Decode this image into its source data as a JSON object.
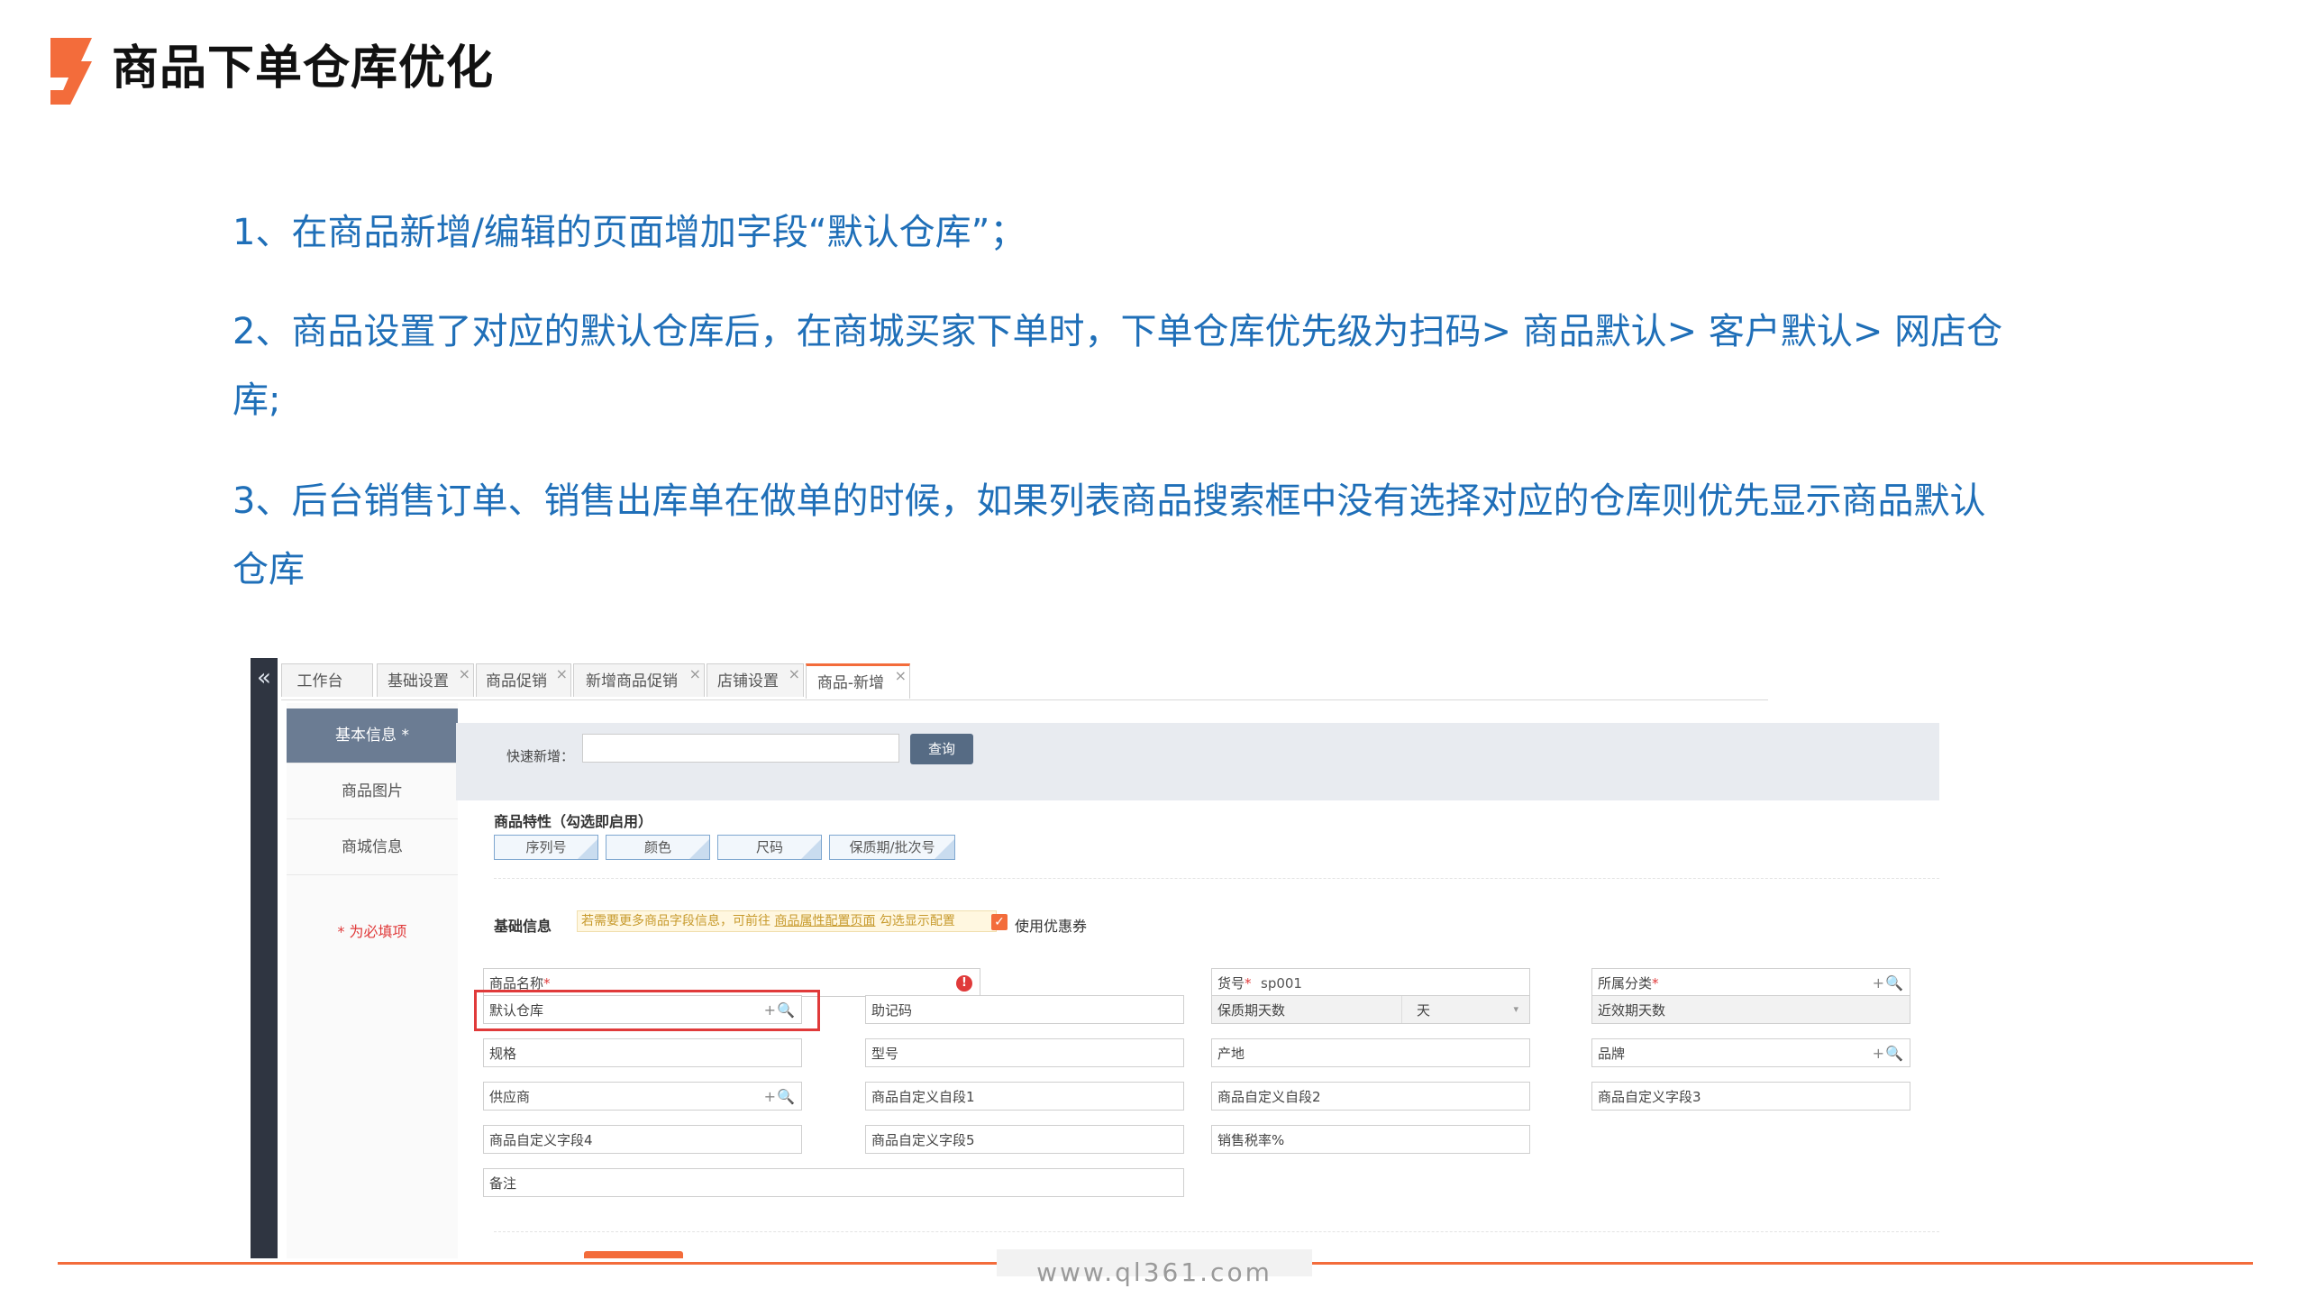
{
  "header": {
    "title": "商品下单仓库优化"
  },
  "bullets": [
    "1、在商品新增/编辑的页面增加字段“默认仓库”；",
    "2、商品设置了对应的默认仓库后，在商城买家下单时，下单仓库优先级为扫码> 商品默认> 客户默认> 网店仓库;",
    "3、后台销售订单、销售出库单在做单的时候，如果列表商品搜索框中没有选择对应的仓库则优先显示商品默认仓库"
  ],
  "screenshot": {
    "collapse_glyph": "«",
    "tabs": [
      {
        "label": "工作台",
        "close": ""
      },
      {
        "label": "基础设置",
        "close": "×"
      },
      {
        "label": "商品促销",
        "close": "×"
      },
      {
        "label": "新增商品促销",
        "close": "×"
      },
      {
        "label": "店铺设置",
        "close": "×"
      },
      {
        "label": "商品-新增",
        "close": "×"
      }
    ],
    "active_tab": "商品-新增",
    "sidenav": {
      "items": [
        "基本信息 *",
        "商品图片",
        "商城信息"
      ],
      "active": "基本信息 *",
      "required_note": "* 为必填项"
    },
    "quick_add": {
      "label": "快速新增：",
      "value": "",
      "button": "查询"
    },
    "attributes": {
      "title": "商品特性（勾选即启用）",
      "tags": [
        "序列号",
        "颜色",
        "尺码",
        "保质期/批次号"
      ]
    },
    "basic_info": {
      "title": "基础信息",
      "hint_prefix": "若需要更多商品字段信息，可前往",
      "hint_link": "商品属性配置页面",
      "hint_suffix": "勾选显示配置",
      "coupon_checked": true,
      "coupon_check_glyph": "✓",
      "coupon_label": "使用优惠券",
      "fields": {
        "name": {
          "label": "商品名称",
          "required": "*",
          "error_glyph": "!"
        },
        "sku": {
          "label": "货号",
          "required": "*",
          "value": "sp001"
        },
        "category": {
          "label": "所属分类",
          "required": "*",
          "icons": "+🔍"
        },
        "default_warehouse": {
          "label": "默认仓库",
          "icons": "+🔍"
        },
        "mnemonic": {
          "label": "助记码"
        },
        "shelf_life": {
          "label": "保质期天数",
          "unit": "天",
          "caret": "▾"
        },
        "near_expiry": {
          "label": "近效期天数"
        },
        "spec": {
          "label": "规格"
        },
        "model": {
          "label": "型号"
        },
        "origin": {
          "label": "产地"
        },
        "brand": {
          "label": "品牌",
          "icons": "+🔍"
        },
        "supplier": {
          "label": "供应商",
          "icons": "+🔍"
        },
        "custom1": {
          "label": "商品自定义自段1"
        },
        "custom2": {
          "label": "商品自定义自段2"
        },
        "custom3": {
          "label": "商品自定义字段3"
        },
        "custom4": {
          "label": "商品自定义字段4"
        },
        "custom5": {
          "label": "商品自定义字段5"
        },
        "tax_rate": {
          "label": "销售税率%"
        },
        "remark": {
          "label": "备注"
        }
      }
    }
  },
  "footer": {
    "url": "www.ql361.com"
  },
  "colors": {
    "accent": "#f36c3b",
    "text_blue": "#1f6fb8",
    "highlight_red": "#e03a3a",
    "nav_active": "#6b7c93"
  }
}
